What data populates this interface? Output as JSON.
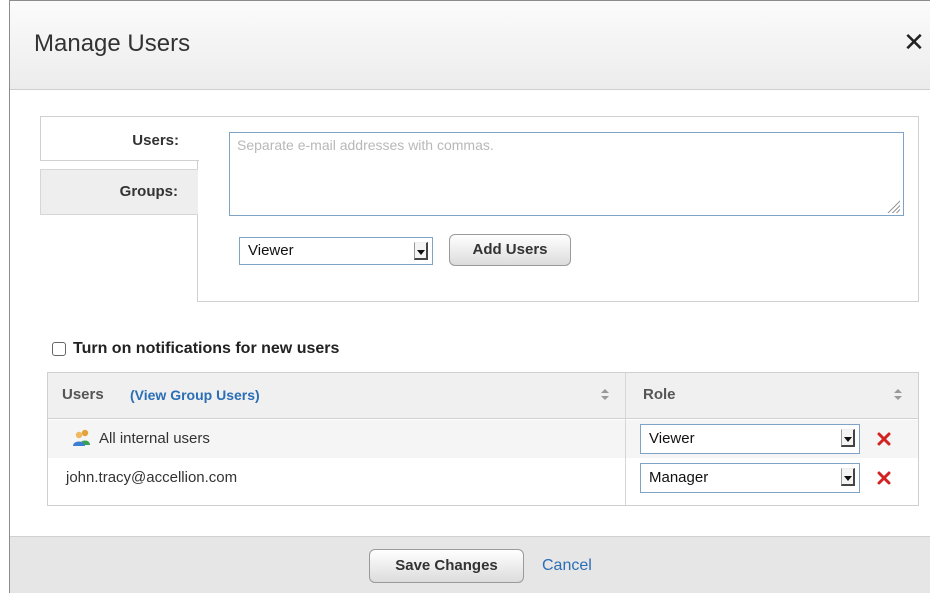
{
  "dialog": {
    "title": "Manage Users"
  },
  "tabs": [
    {
      "label": "Users:",
      "active": true
    },
    {
      "label": "Groups:",
      "active": false
    }
  ],
  "email_input": {
    "placeholder": "Separate e-mail addresses with commas.",
    "value": ""
  },
  "add_role_select": {
    "selected": "Viewer"
  },
  "add_users_button": {
    "label": "Add Users"
  },
  "notifications": {
    "label": "Turn on notifications for new users",
    "checked": false
  },
  "table": {
    "headers": {
      "users": "Users",
      "view_group_users": "(View Group Users)",
      "role": "Role"
    },
    "rows": [
      {
        "user": "All internal users",
        "role": "Viewer",
        "icon": "group-icon"
      },
      {
        "user": "john.tracy@accellion.com",
        "role": "Manager"
      }
    ]
  },
  "footer": {
    "save_label": "Save Changes",
    "cancel_label": "Cancel"
  },
  "colors": {
    "link": "#2a6eb5",
    "remove": "#d22222",
    "input_border": "#7fa3c4"
  }
}
